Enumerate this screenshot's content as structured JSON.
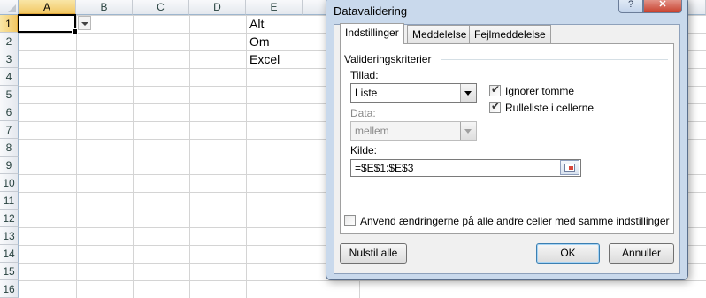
{
  "sheet": {
    "columns": [
      "A",
      "B",
      "C",
      "D",
      "E"
    ],
    "rows": [
      "1",
      "2",
      "3",
      "4",
      "5",
      "6",
      "7",
      "8",
      "9",
      "10",
      "11",
      "12",
      "13",
      "14",
      "15",
      "16"
    ],
    "cells": {
      "E1": "Alt",
      "E2": "Om",
      "E3": "Excel"
    }
  },
  "dialog": {
    "title": "Datavalidering",
    "help_label": "?",
    "close_label": "✕",
    "tabs": [
      "Indstillinger",
      "Meddelelse",
      "Fejlmeddelelse"
    ],
    "group_label": "Valideringskriterier",
    "allow_label": "Tillad:",
    "allow_value": "Liste",
    "data_label": "Data:",
    "data_value": "mellem",
    "ignore_blank_label": "Ignorer tomme",
    "incell_dropdown_label": "Rulleliste i cellerne",
    "source_label": "Kilde:",
    "source_value": "=$E$1:$E$3",
    "apply_all_label": "Anvend ændringerne på alle andre celler med samme indstillinger",
    "clear_all_label": "Nulstil alle",
    "ok_label": "OK",
    "cancel_label": "Annuller"
  },
  "state": {
    "ignore_blank_checked": true,
    "incell_dropdown_checked": true,
    "apply_all_checked": false
  }
}
